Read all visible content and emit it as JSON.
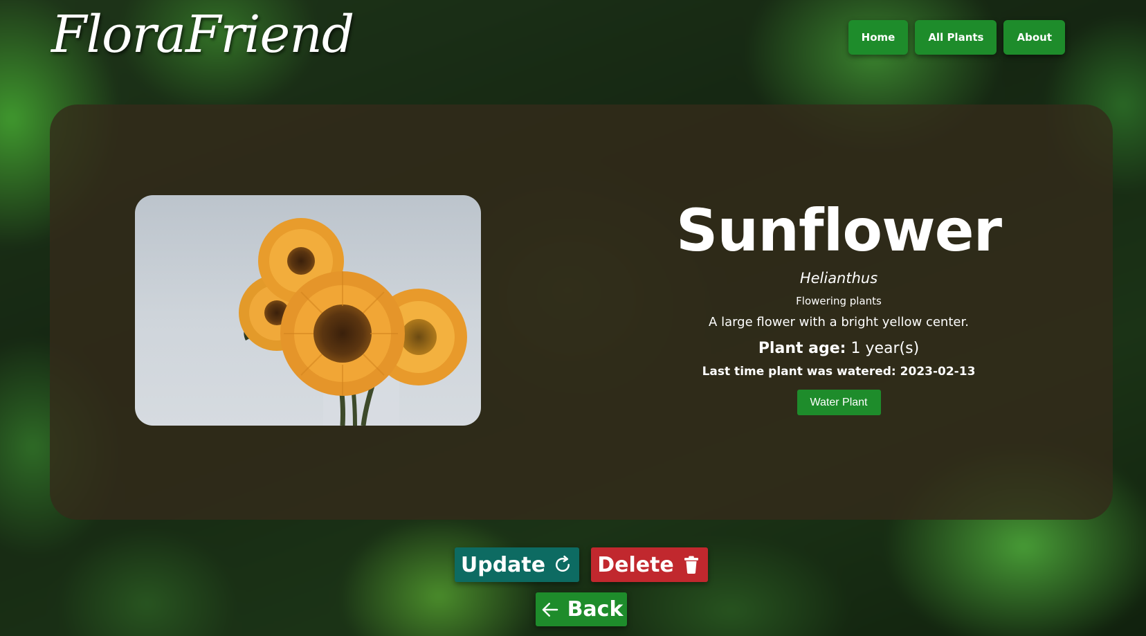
{
  "header": {
    "logo": "FloraFriend",
    "nav": [
      {
        "label": "Home"
      },
      {
        "label": "All Plants"
      },
      {
        "label": "About"
      }
    ]
  },
  "plant": {
    "name": "Sunflower",
    "scientific_name": "Helianthus",
    "category": "Flowering plants",
    "description": "A large flower with a bright yellow center.",
    "age_label": "Plant age:",
    "age_value": "1 year(s)",
    "last_watered_label": "Last time plant was watered:",
    "last_watered_date": "2023-02-13",
    "water_button": "Water Plant"
  },
  "actions": {
    "update_label": "Update",
    "update_icon": "refresh-icon",
    "delete_label": "Delete",
    "delete_icon": "trash-icon",
    "back_label": "Back",
    "back_icon": "arrow-left-icon"
  },
  "colors": {
    "nav_green": "#1e8c2b",
    "update_teal": "#0d6b62",
    "delete_red": "#c1282e",
    "card_brown": "#342b1a"
  }
}
